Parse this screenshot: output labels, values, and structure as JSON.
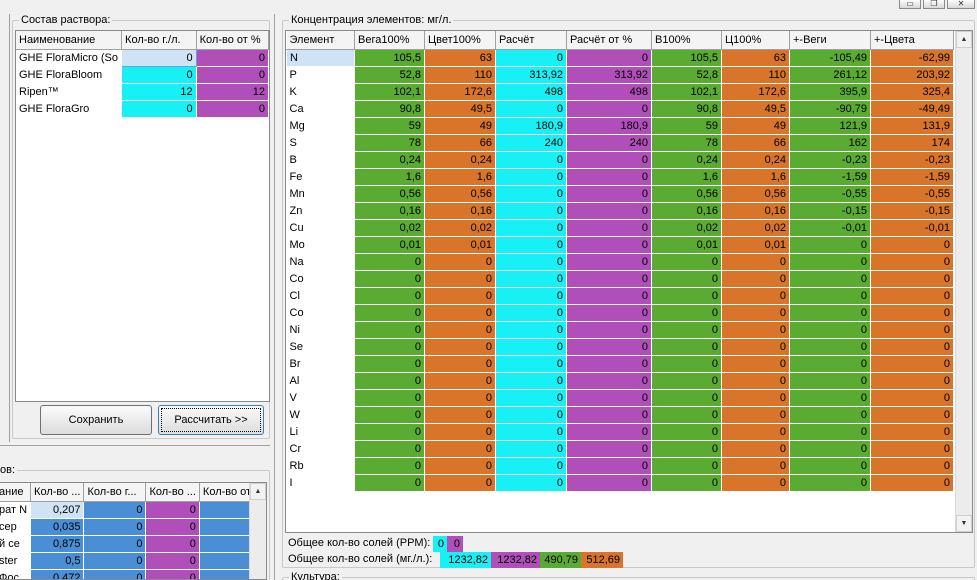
{
  "window": {
    "minimize_glyph": "▭",
    "restore_glyph": "❐",
    "close_glyph": "✕"
  },
  "solution": {
    "title": "Состав раствора:",
    "columns": [
      "Наименование",
      "Кол-во г./л.",
      "Кол-во от %"
    ],
    "rows": [
      {
        "name": "GHE FloraMicro (So",
        "g": "0",
        "pct": "0"
      },
      {
        "name": "GHE FloraBloom",
        "g": "0",
        "pct": "0"
      },
      {
        "name": "Ripen™",
        "g": "12",
        "pct": "12"
      },
      {
        "name": "GHE FloraGro",
        "g": "0",
        "pct": "0"
      }
    ],
    "save_label": "Сохранить",
    "calc_label": "Рассчитать >>"
  },
  "bottom_left": {
    "title": "ов:",
    "columns": [
      "ание",
      "Кол-во ...",
      "Кол-во г...",
      "Кол-во ...",
      "Кол-во от..."
    ],
    "rows": [
      {
        "name": "рат N",
        "a": "0,207",
        "b": "0",
        "c": "0",
        "d": "0"
      },
      {
        "name": "сер",
        "a": "0,035",
        "b": "0",
        "c": "0",
        "d": "0"
      },
      {
        "name": "й се",
        "a": "0,875",
        "b": "0",
        "c": "0",
        "d": "0"
      },
      {
        "name": "ster",
        "a": "0,5",
        "b": "0",
        "c": "0",
        "d": "0"
      },
      {
        "name": "Фос",
        "a": "0,472",
        "b": "0",
        "c": "0",
        "d": "0"
      }
    ]
  },
  "concentration": {
    "title": "Концентрация элементов: мг/л.",
    "columns": [
      "Элемент",
      "Вега100%",
      "Цвет100%",
      "Расчёт",
      "Расчёт от %",
      "В100%",
      "Ц100%",
      "+-Веги",
      "+-Цвета"
    ],
    "rows": [
      [
        "N",
        "105,5",
        "63",
        "0",
        "0",
        "105,5",
        "63",
        "-105,49",
        "-62,99"
      ],
      [
        "P",
        "52,8",
        "110",
        "313,92",
        "313,92",
        "52,8",
        "110",
        "261,12",
        "203,92"
      ],
      [
        "K",
        "102,1",
        "172,6",
        "498",
        "498",
        "102,1",
        "172,6",
        "395,9",
        "325,4"
      ],
      [
        "Ca",
        "90,8",
        "49,5",
        "0",
        "0",
        "90,8",
        "49,5",
        "-90,79",
        "-49,49"
      ],
      [
        "Mg",
        "59",
        "49",
        "180,9",
        "180,9",
        "59",
        "49",
        "121,9",
        "131,9"
      ],
      [
        "S",
        "78",
        "66",
        "240",
        "240",
        "78",
        "66",
        "162",
        "174"
      ],
      [
        "B",
        "0,24",
        "0,24",
        "0",
        "0",
        "0,24",
        "0,24",
        "-0,23",
        "-0,23"
      ],
      [
        "Fe",
        "1,6",
        "1,6",
        "0",
        "0",
        "1,6",
        "1,6",
        "-1,59",
        "-1,59"
      ],
      [
        "Mn",
        "0,56",
        "0,56",
        "0",
        "0",
        "0,56",
        "0,56",
        "-0,55",
        "-0,55"
      ],
      [
        "Zn",
        "0,16",
        "0,16",
        "0",
        "0",
        "0,16",
        "0,16",
        "-0,15",
        "-0,15"
      ],
      [
        "Cu",
        "0,02",
        "0,02",
        "0",
        "0",
        "0,02",
        "0,02",
        "-0,01",
        "-0,01"
      ],
      [
        "Mo",
        "0,01",
        "0,01",
        "0",
        "0",
        "0,01",
        "0,01",
        "0",
        "0"
      ],
      [
        "Na",
        "0",
        "0",
        "0",
        "0",
        "0",
        "0",
        "0",
        "0"
      ],
      [
        "Co",
        "0",
        "0",
        "0",
        "0",
        "0",
        "0",
        "0",
        "0"
      ],
      [
        "Cl",
        "0",
        "0",
        "0",
        "0",
        "0",
        "0",
        "0",
        "0"
      ],
      [
        "Co",
        "0",
        "0",
        "0",
        "0",
        "0",
        "0",
        "0",
        "0"
      ],
      [
        "Ni",
        "0",
        "0",
        "0",
        "0",
        "0",
        "0",
        "0",
        "0"
      ],
      [
        "Se",
        "0",
        "0",
        "0",
        "0",
        "0",
        "0",
        "0",
        "0"
      ],
      [
        "Br",
        "0",
        "0",
        "0",
        "0",
        "0",
        "0",
        "0",
        "0"
      ],
      [
        "Al",
        "0",
        "0",
        "0",
        "0",
        "0",
        "0",
        "0",
        "0"
      ],
      [
        "V",
        "0",
        "0",
        "0",
        "0",
        "0",
        "0",
        "0",
        "0"
      ],
      [
        "W",
        "0",
        "0",
        "0",
        "0",
        "0",
        "0",
        "0",
        "0"
      ],
      [
        "Li",
        "0",
        "0",
        "0",
        "0",
        "0",
        "0",
        "0",
        "0"
      ],
      [
        "Cr",
        "0",
        "0",
        "0",
        "0",
        "0",
        "0",
        "0",
        "0"
      ],
      [
        "Rb",
        "0",
        "0",
        "0",
        "0",
        "0",
        "0",
        "0",
        "0"
      ],
      [
        "I",
        "0",
        "0",
        "0",
        "0",
        "0",
        "0",
        "0",
        "0"
      ]
    ],
    "column_colors": [
      "#ffffff",
      "#5aab31",
      "#d9742b",
      "#17f1f5",
      "#b04fba",
      "#5aab31",
      "#d9742b",
      "#5aab31",
      "#d9742b"
    ],
    "ppm_label": "Общее кол-во солей (PPM):",
    "ppm_values": [
      "0",
      "0"
    ],
    "mgl_label": "Общее кол-во солей (мг./л.):",
    "mgl_values": [
      "1232,82",
      "1232,82",
      "490,79",
      "512,69"
    ]
  },
  "culture": {
    "title": "Культура:"
  },
  "scroll": {
    "up": "▲",
    "down": "▼"
  }
}
